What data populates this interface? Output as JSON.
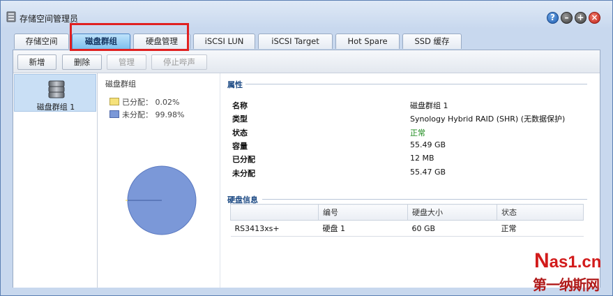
{
  "window": {
    "title": "存储空间管理员",
    "buttons": {
      "help": "?",
      "minimize": "–",
      "maximize": "+",
      "close": "×"
    }
  },
  "tabs": [
    {
      "label": "存储空间",
      "active": false
    },
    {
      "label": "磁盘群组",
      "active": true
    },
    {
      "label": "硬盘管理",
      "active": false
    },
    {
      "label": "iSCSI LUN",
      "active": false
    },
    {
      "label": "iSCSI Target",
      "active": false
    },
    {
      "label": "Hot Spare",
      "active": false
    },
    {
      "label": "SSD 缓存",
      "active": false
    }
  ],
  "toolbar": {
    "create": "新增",
    "delete": "删除",
    "manage": "管理",
    "stop_beep": "停止哔声"
  },
  "disk_groups": [
    {
      "label": "磁盘群组 1",
      "icon": "disk-stack-icon"
    }
  ],
  "usage": {
    "title": "磁盘群组",
    "allocated_label": "已分配：",
    "allocated_pct": "0.02%",
    "unallocated_label": "未分配：",
    "unallocated_pct": "99.98%",
    "allocated_fraction": 0.0002,
    "colors": {
      "allocated": "#f6e27a",
      "unallocated": "#7b98d8"
    }
  },
  "properties": {
    "section_title": "属性",
    "items": [
      {
        "label": "名称",
        "value": "磁盘群组 1",
        "status": false
      },
      {
        "label": "类型",
        "value": "Synology Hybrid RAID (SHR) (无数据保护)",
        "status": false
      },
      {
        "label": "状态",
        "value": "正常",
        "status": true
      },
      {
        "label": "容量",
        "value": "55.49 GB",
        "status": false
      },
      {
        "label": "已分配",
        "value": "12 MB",
        "status": false
      },
      {
        "label": "未分配",
        "value": "55.47 GB",
        "status": false
      }
    ]
  },
  "disk_info": {
    "section_title": "硬盘信息",
    "columns": [
      "",
      "编号",
      "硬盘大小",
      "状态"
    ],
    "rows": [
      [
        "RS3413xs+",
        "硬盘 1",
        "60 GB",
        "正常"
      ]
    ]
  },
  "watermark": {
    "line1_n": "N",
    "line1_rest": "as1.cn",
    "line2": "第一纳斯网"
  }
}
